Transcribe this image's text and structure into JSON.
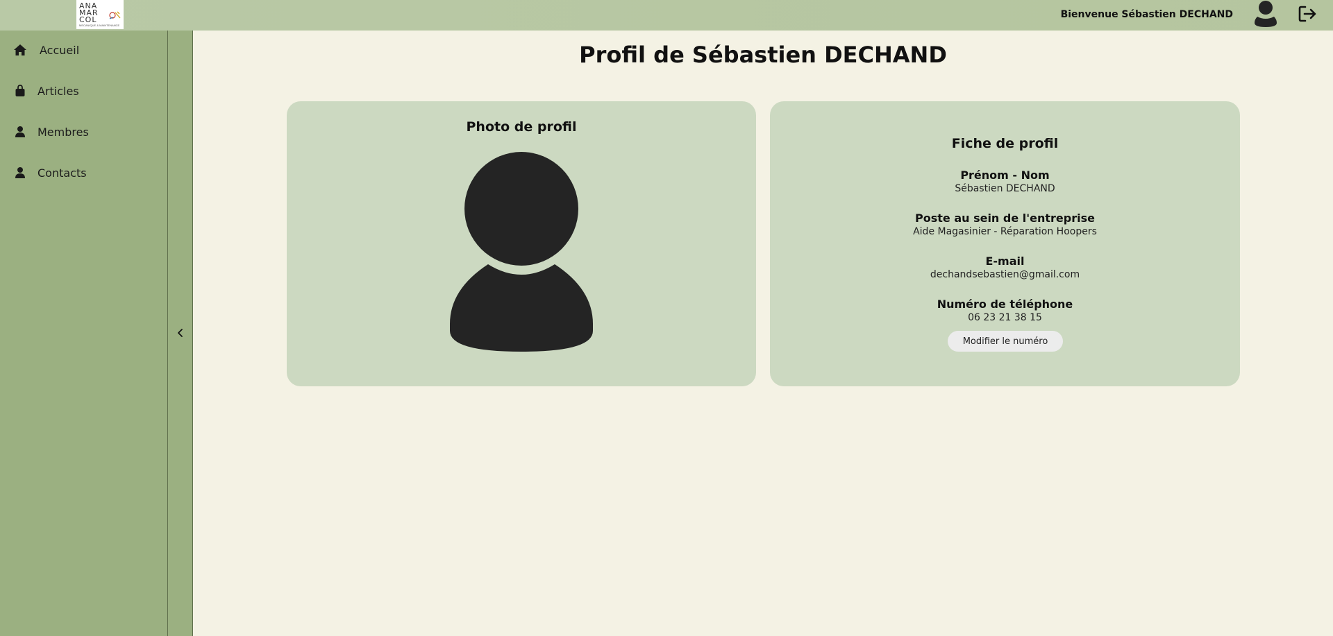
{
  "header": {
    "logo_lines": [
      "ANA",
      "MAR",
      "COL"
    ],
    "logo_tagline": "MECANIQUE & MAINTENANCE",
    "welcome_text": "Bienvenue Sébastien DECHAND"
  },
  "sidebar": {
    "items": [
      {
        "label": "Accueil",
        "icon": "home-icon"
      },
      {
        "label": "Articles",
        "icon": "bag-icon"
      },
      {
        "label": "Membres",
        "icon": "user-icon"
      },
      {
        "label": "Contacts",
        "icon": "user-icon"
      }
    ]
  },
  "main": {
    "title": "Profil de Sébastien DECHAND",
    "photo_card": {
      "title": "Photo de profil"
    },
    "info_card": {
      "title": "Fiche de profil",
      "fields": [
        {
          "label": "Prénom - Nom",
          "value": "Sébastien DECHAND"
        },
        {
          "label": "Poste au sein de l'entreprise",
          "value": "Aide Magasinier - Réparation Hoopers"
        },
        {
          "label": "E-mail",
          "value": "dechandsebastien@gmail.com"
        },
        {
          "label": "Numéro de téléphone",
          "value": "06 23 21 38 15"
        }
      ],
      "edit_button": "Modifier le numéro"
    }
  },
  "colors": {
    "topbar": "#b5c59f",
    "sidebar": "#9bb081",
    "background": "#f4f2e4",
    "card": "#ccd9c1",
    "icon_dark": "#242424"
  }
}
